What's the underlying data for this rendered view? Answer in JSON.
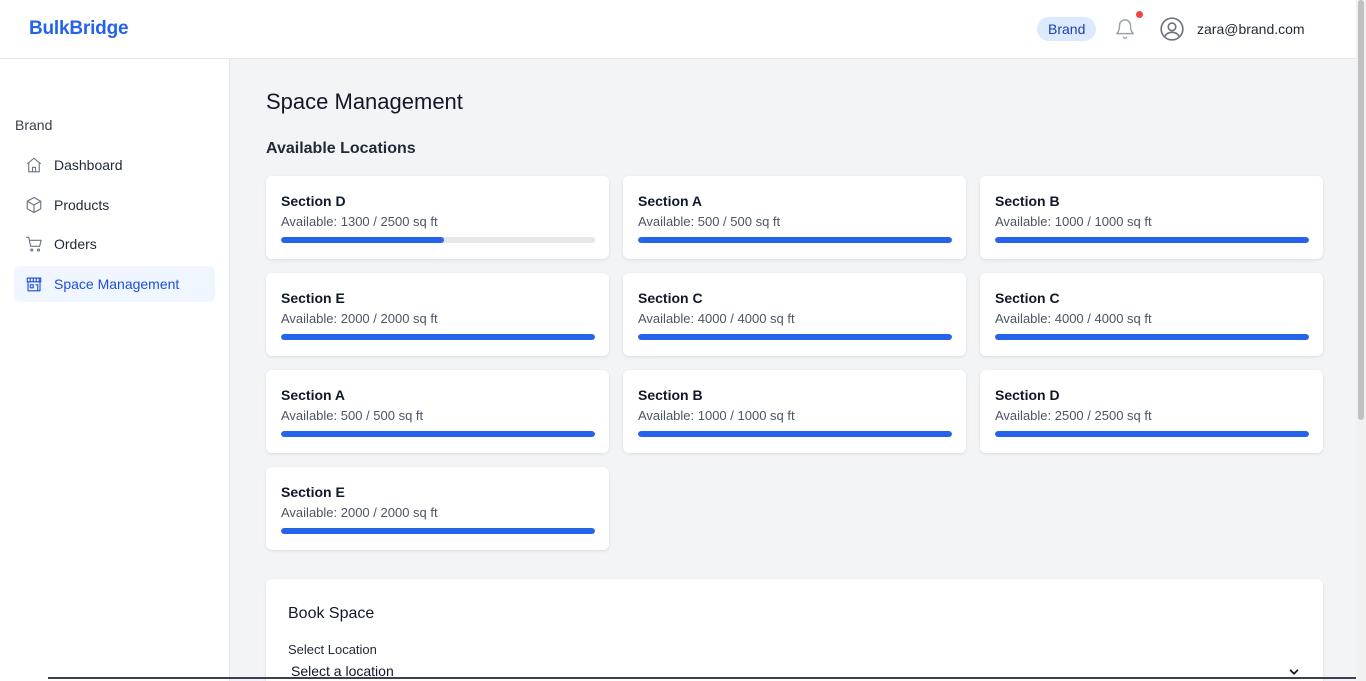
{
  "header": {
    "logo": "BulkBridge",
    "role_badge": "Brand",
    "user_email": "zara@brand.com",
    "icons": [
      "bell-icon",
      "user-circle-icon"
    ],
    "notification_dot_color": "#ef4444"
  },
  "sidebar": {
    "section_label": "Brand",
    "items": [
      {
        "label": "Dashboard",
        "icon": "home-icon",
        "active": false
      },
      {
        "label": "Products",
        "icon": "cube-icon",
        "active": false
      },
      {
        "label": "Orders",
        "icon": "cart-icon",
        "active": false
      },
      {
        "label": "Space Management",
        "icon": "store-icon",
        "active": true
      }
    ]
  },
  "main": {
    "title": "Space Management",
    "locations_title": "Available Locations",
    "locations": [
      {
        "name": "Section D",
        "available": "Available: 1300 / 2500 sq ft",
        "fill": 0.52
      },
      {
        "name": "Section A",
        "available": "Available: 500 / 500 sq ft",
        "fill": 1.0
      },
      {
        "name": "Section B",
        "available": "Available: 1000 / 1000 sq ft",
        "fill": 1.0
      },
      {
        "name": "Section E",
        "available": "Available: 2000 / 2000 sq ft",
        "fill": 1.0
      },
      {
        "name": "Section C",
        "available": "Available: 4000 / 4000 sq ft",
        "fill": 1.0
      },
      {
        "name": "Section C",
        "available": "Available: 4000 / 4000 sq ft",
        "fill": 1.0
      },
      {
        "name": "Section A",
        "available": "Available: 500 / 500 sq ft",
        "fill": 1.0
      },
      {
        "name": "Section B",
        "available": "Available: 1000 / 1000 sq ft",
        "fill": 1.0
      },
      {
        "name": "Section D",
        "available": "Available: 2500 / 2500 sq ft",
        "fill": 1.0
      },
      {
        "name": "Section E",
        "available": "Available: 2000 / 2000 sq ft",
        "fill": 1.0
      }
    ],
    "book_space": {
      "title": "Book Space",
      "location_label": "Select Location",
      "location_value": "Select a location"
    }
  },
  "colors": {
    "accent": "#2563eb",
    "active_nav_bg": "#eff6ff",
    "page_bg": "#f3f4f6"
  }
}
